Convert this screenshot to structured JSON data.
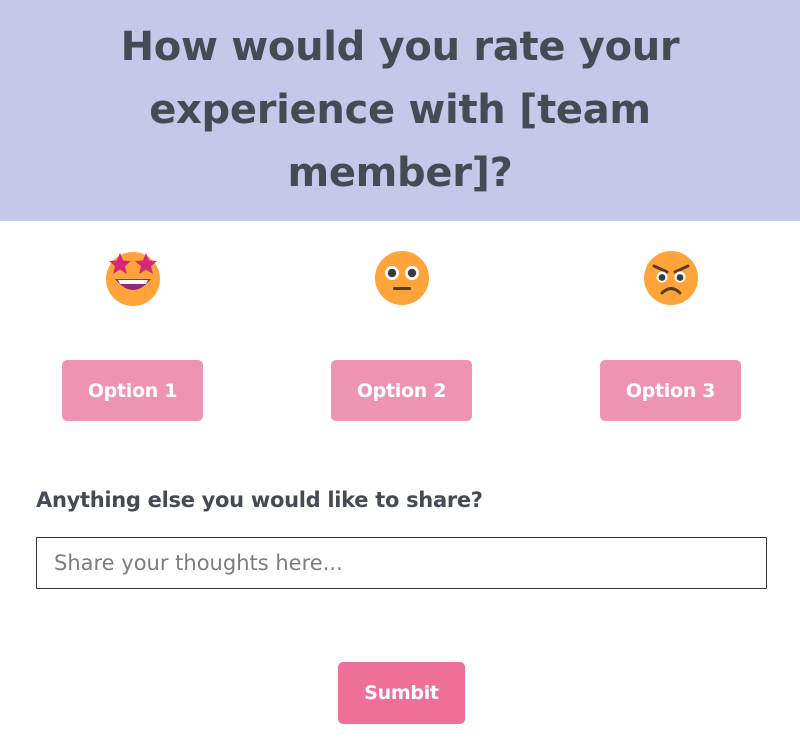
{
  "header": {
    "title": "How would you rate your experience with [team member]?"
  },
  "options": [
    {
      "label": "Option 1",
      "icon": "star-struck-emoji-icon"
    },
    {
      "label": "Option 2",
      "icon": "neutral-face-emoji-icon"
    },
    {
      "label": "Option 3",
      "icon": "angry-face-emoji-icon"
    }
  ],
  "feedback": {
    "question": "Anything else you would like to share?",
    "placeholder": "Share your thoughts here...",
    "value": ""
  },
  "submit": {
    "label": "Sumbit"
  },
  "colors": {
    "header_bg": "#c5c8e8",
    "text": "#464a54",
    "option_button": "#ef93b2",
    "submit_button": "#ee6f98",
    "emoji_face": "#ffa43a",
    "emoji_accent": "#d6287b"
  }
}
